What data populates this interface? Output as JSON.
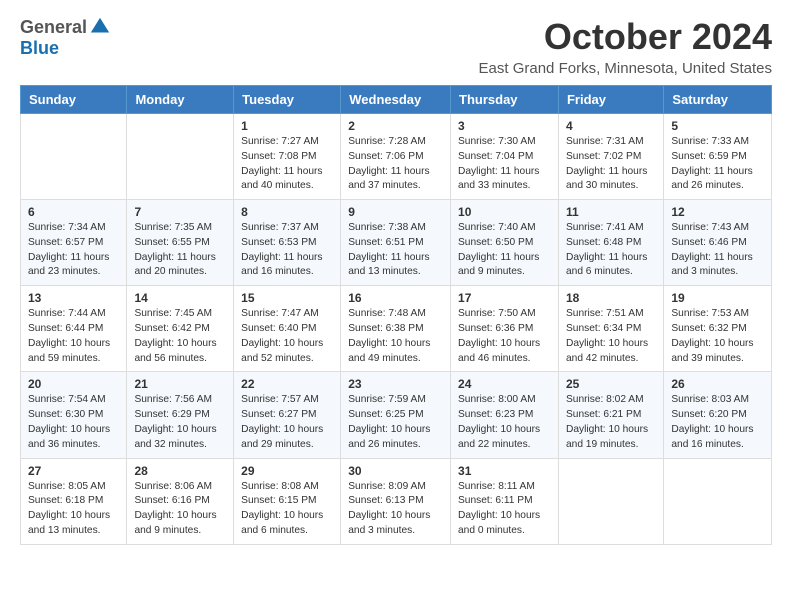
{
  "header": {
    "logo_general": "General",
    "logo_blue": "Blue",
    "month_title": "October 2024",
    "location": "East Grand Forks, Minnesota, United States"
  },
  "weekdays": [
    "Sunday",
    "Monday",
    "Tuesday",
    "Wednesday",
    "Thursday",
    "Friday",
    "Saturday"
  ],
  "weeks": [
    [
      {
        "day": "",
        "info": ""
      },
      {
        "day": "",
        "info": ""
      },
      {
        "day": "1",
        "info": "Sunrise: 7:27 AM\nSunset: 7:08 PM\nDaylight: 11 hours and 40 minutes."
      },
      {
        "day": "2",
        "info": "Sunrise: 7:28 AM\nSunset: 7:06 PM\nDaylight: 11 hours and 37 minutes."
      },
      {
        "day": "3",
        "info": "Sunrise: 7:30 AM\nSunset: 7:04 PM\nDaylight: 11 hours and 33 minutes."
      },
      {
        "day": "4",
        "info": "Sunrise: 7:31 AM\nSunset: 7:02 PM\nDaylight: 11 hours and 30 minutes."
      },
      {
        "day": "5",
        "info": "Sunrise: 7:33 AM\nSunset: 6:59 PM\nDaylight: 11 hours and 26 minutes."
      }
    ],
    [
      {
        "day": "6",
        "info": "Sunrise: 7:34 AM\nSunset: 6:57 PM\nDaylight: 11 hours and 23 minutes."
      },
      {
        "day": "7",
        "info": "Sunrise: 7:35 AM\nSunset: 6:55 PM\nDaylight: 11 hours and 20 minutes."
      },
      {
        "day": "8",
        "info": "Sunrise: 7:37 AM\nSunset: 6:53 PM\nDaylight: 11 hours and 16 minutes."
      },
      {
        "day": "9",
        "info": "Sunrise: 7:38 AM\nSunset: 6:51 PM\nDaylight: 11 hours and 13 minutes."
      },
      {
        "day": "10",
        "info": "Sunrise: 7:40 AM\nSunset: 6:50 PM\nDaylight: 11 hours and 9 minutes."
      },
      {
        "day": "11",
        "info": "Sunrise: 7:41 AM\nSunset: 6:48 PM\nDaylight: 11 hours and 6 minutes."
      },
      {
        "day": "12",
        "info": "Sunrise: 7:43 AM\nSunset: 6:46 PM\nDaylight: 11 hours and 3 minutes."
      }
    ],
    [
      {
        "day": "13",
        "info": "Sunrise: 7:44 AM\nSunset: 6:44 PM\nDaylight: 10 hours and 59 minutes."
      },
      {
        "day": "14",
        "info": "Sunrise: 7:45 AM\nSunset: 6:42 PM\nDaylight: 10 hours and 56 minutes."
      },
      {
        "day": "15",
        "info": "Sunrise: 7:47 AM\nSunset: 6:40 PM\nDaylight: 10 hours and 52 minutes."
      },
      {
        "day": "16",
        "info": "Sunrise: 7:48 AM\nSunset: 6:38 PM\nDaylight: 10 hours and 49 minutes."
      },
      {
        "day": "17",
        "info": "Sunrise: 7:50 AM\nSunset: 6:36 PM\nDaylight: 10 hours and 46 minutes."
      },
      {
        "day": "18",
        "info": "Sunrise: 7:51 AM\nSunset: 6:34 PM\nDaylight: 10 hours and 42 minutes."
      },
      {
        "day": "19",
        "info": "Sunrise: 7:53 AM\nSunset: 6:32 PM\nDaylight: 10 hours and 39 minutes."
      }
    ],
    [
      {
        "day": "20",
        "info": "Sunrise: 7:54 AM\nSunset: 6:30 PM\nDaylight: 10 hours and 36 minutes."
      },
      {
        "day": "21",
        "info": "Sunrise: 7:56 AM\nSunset: 6:29 PM\nDaylight: 10 hours and 32 minutes."
      },
      {
        "day": "22",
        "info": "Sunrise: 7:57 AM\nSunset: 6:27 PM\nDaylight: 10 hours and 29 minutes."
      },
      {
        "day": "23",
        "info": "Sunrise: 7:59 AM\nSunset: 6:25 PM\nDaylight: 10 hours and 26 minutes."
      },
      {
        "day": "24",
        "info": "Sunrise: 8:00 AM\nSunset: 6:23 PM\nDaylight: 10 hours and 22 minutes."
      },
      {
        "day": "25",
        "info": "Sunrise: 8:02 AM\nSunset: 6:21 PM\nDaylight: 10 hours and 19 minutes."
      },
      {
        "day": "26",
        "info": "Sunrise: 8:03 AM\nSunset: 6:20 PM\nDaylight: 10 hours and 16 minutes."
      }
    ],
    [
      {
        "day": "27",
        "info": "Sunrise: 8:05 AM\nSunset: 6:18 PM\nDaylight: 10 hours and 13 minutes."
      },
      {
        "day": "28",
        "info": "Sunrise: 8:06 AM\nSunset: 6:16 PM\nDaylight: 10 hours and 9 minutes."
      },
      {
        "day": "29",
        "info": "Sunrise: 8:08 AM\nSunset: 6:15 PM\nDaylight: 10 hours and 6 minutes."
      },
      {
        "day": "30",
        "info": "Sunrise: 8:09 AM\nSunset: 6:13 PM\nDaylight: 10 hours and 3 minutes."
      },
      {
        "day": "31",
        "info": "Sunrise: 8:11 AM\nSunset: 6:11 PM\nDaylight: 10 hours and 0 minutes."
      },
      {
        "day": "",
        "info": ""
      },
      {
        "day": "",
        "info": ""
      }
    ]
  ]
}
